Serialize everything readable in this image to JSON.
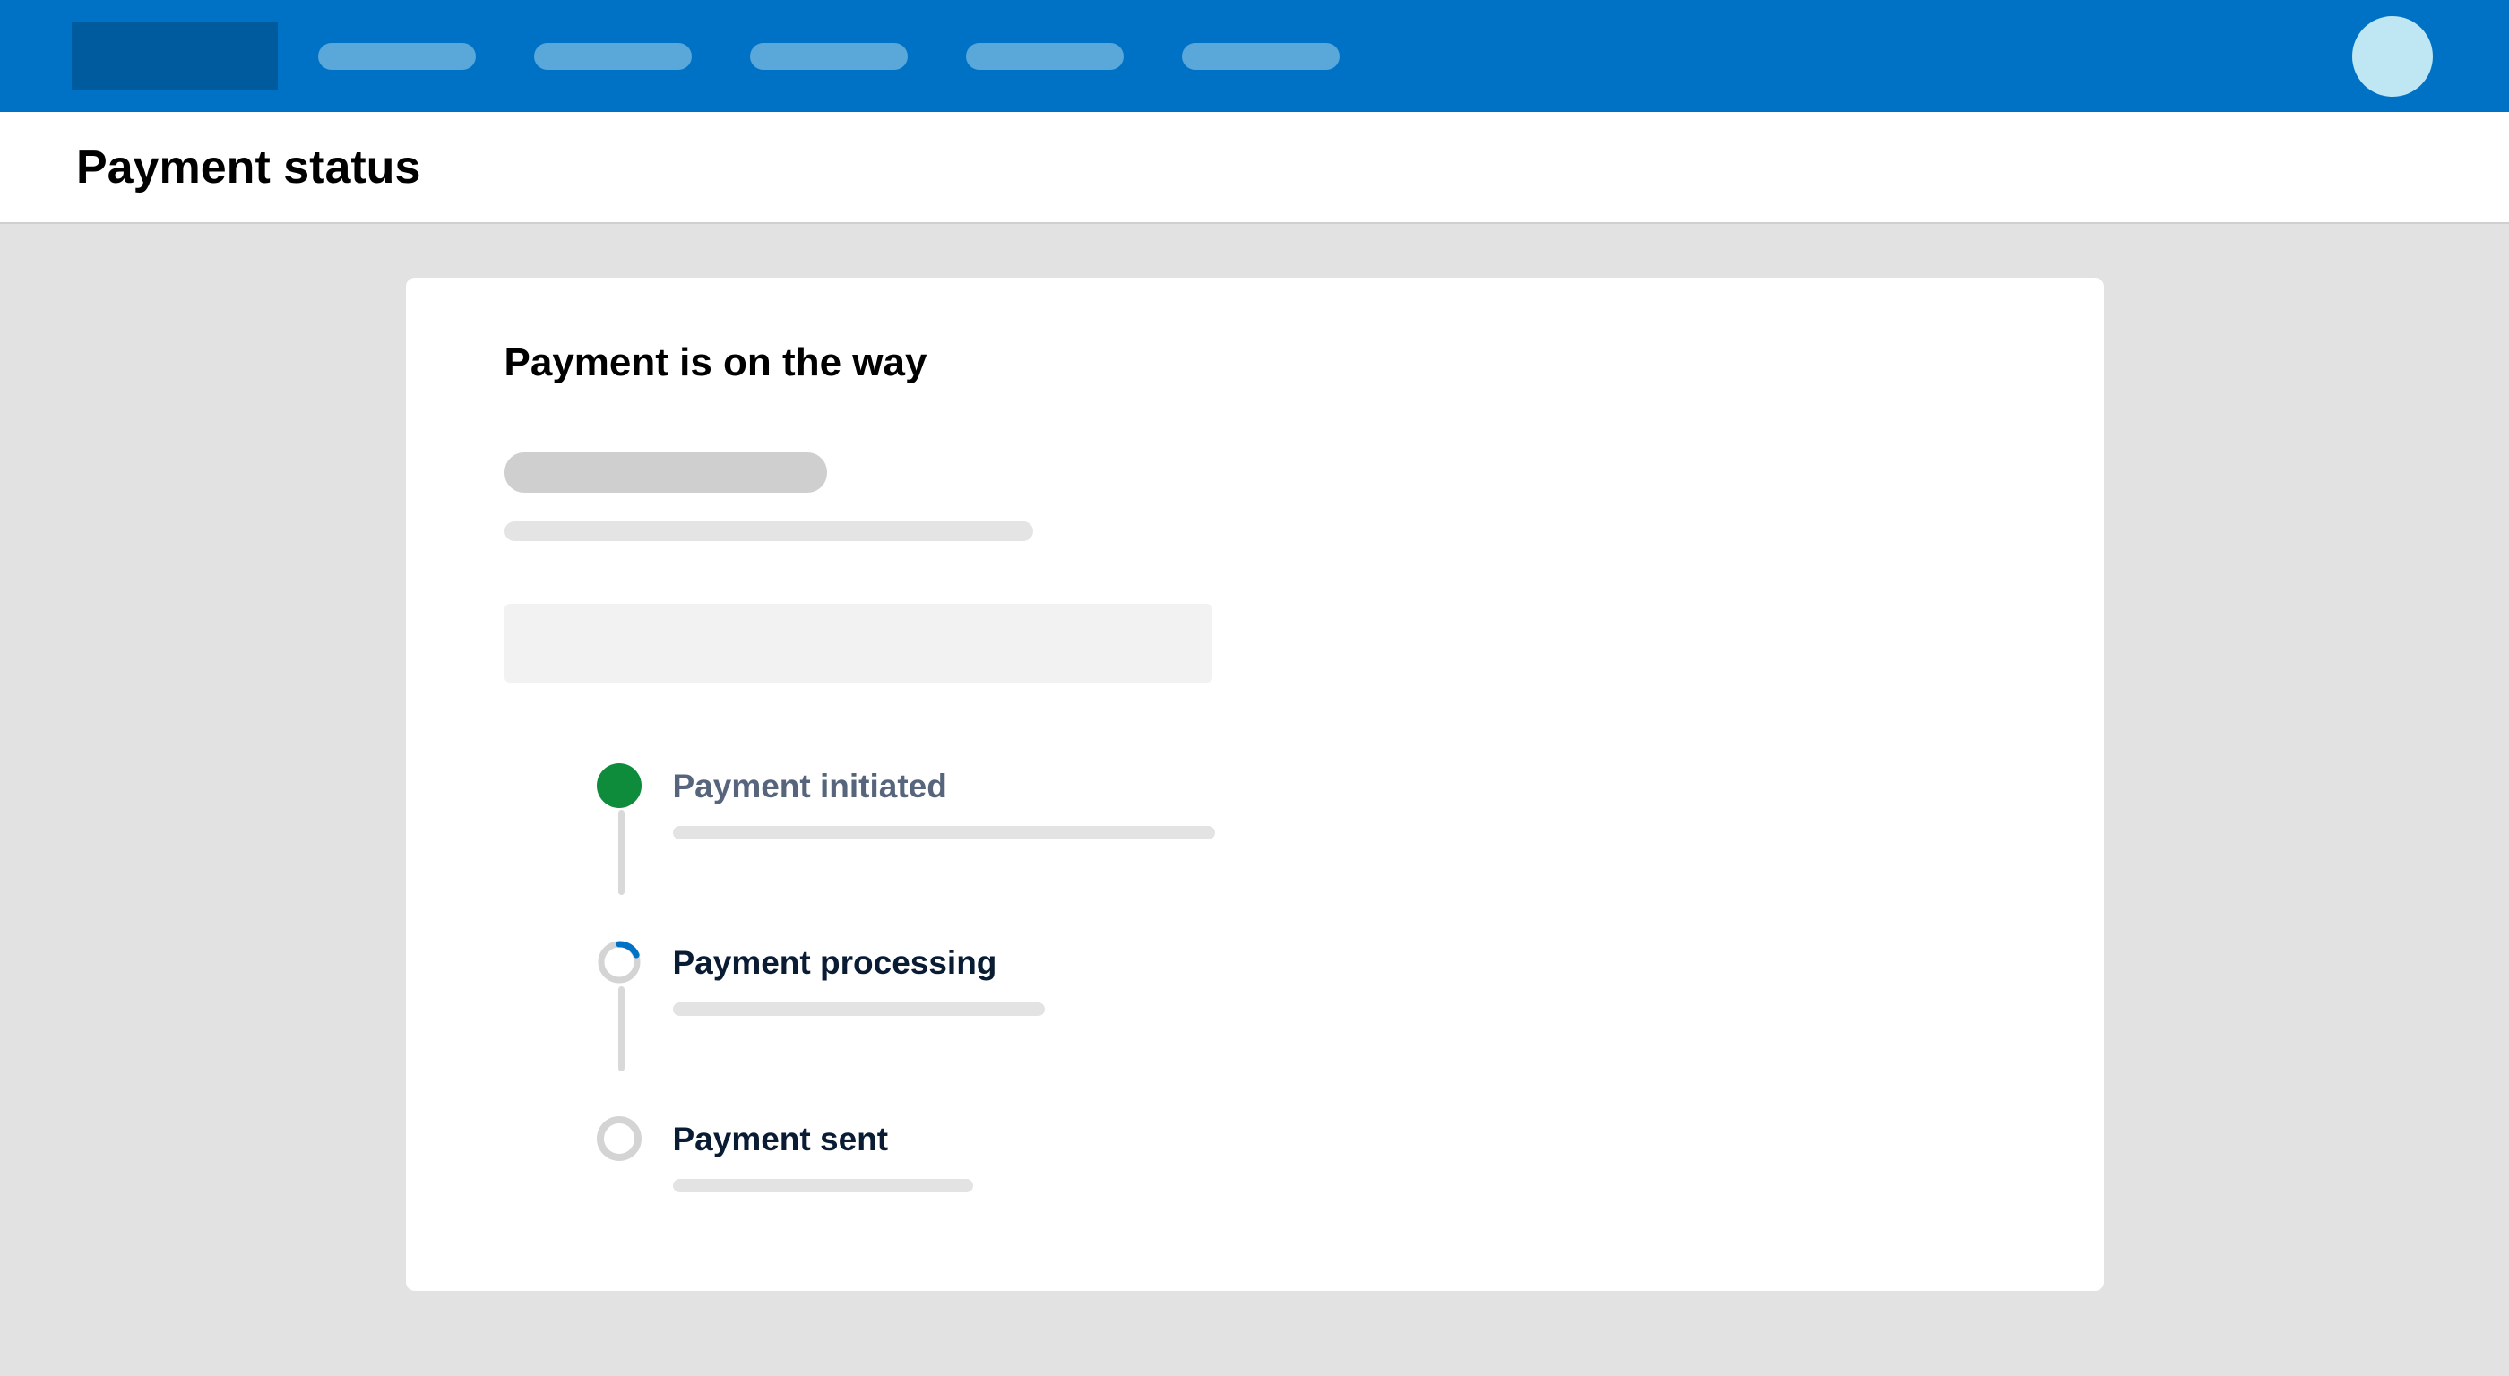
{
  "page": {
    "title": "Payment status"
  },
  "card": {
    "title": "Payment is on the way"
  },
  "steps": [
    {
      "label": "Payment initiated",
      "state": "completed"
    },
    {
      "label": "Payment processing",
      "state": "current"
    },
    {
      "label": "Payment sent",
      "state": "pending"
    }
  ],
  "colors": {
    "nav_bg": "#0072c6",
    "nav_logo_bg": "#005a9e",
    "nav_link_bg": "#5aa7da",
    "avatar_bg": "#bfe7f3",
    "page_bg": "#e2e2e2",
    "complete_dot": "#0f8b3c",
    "spinner_accent": "#0072c6"
  }
}
